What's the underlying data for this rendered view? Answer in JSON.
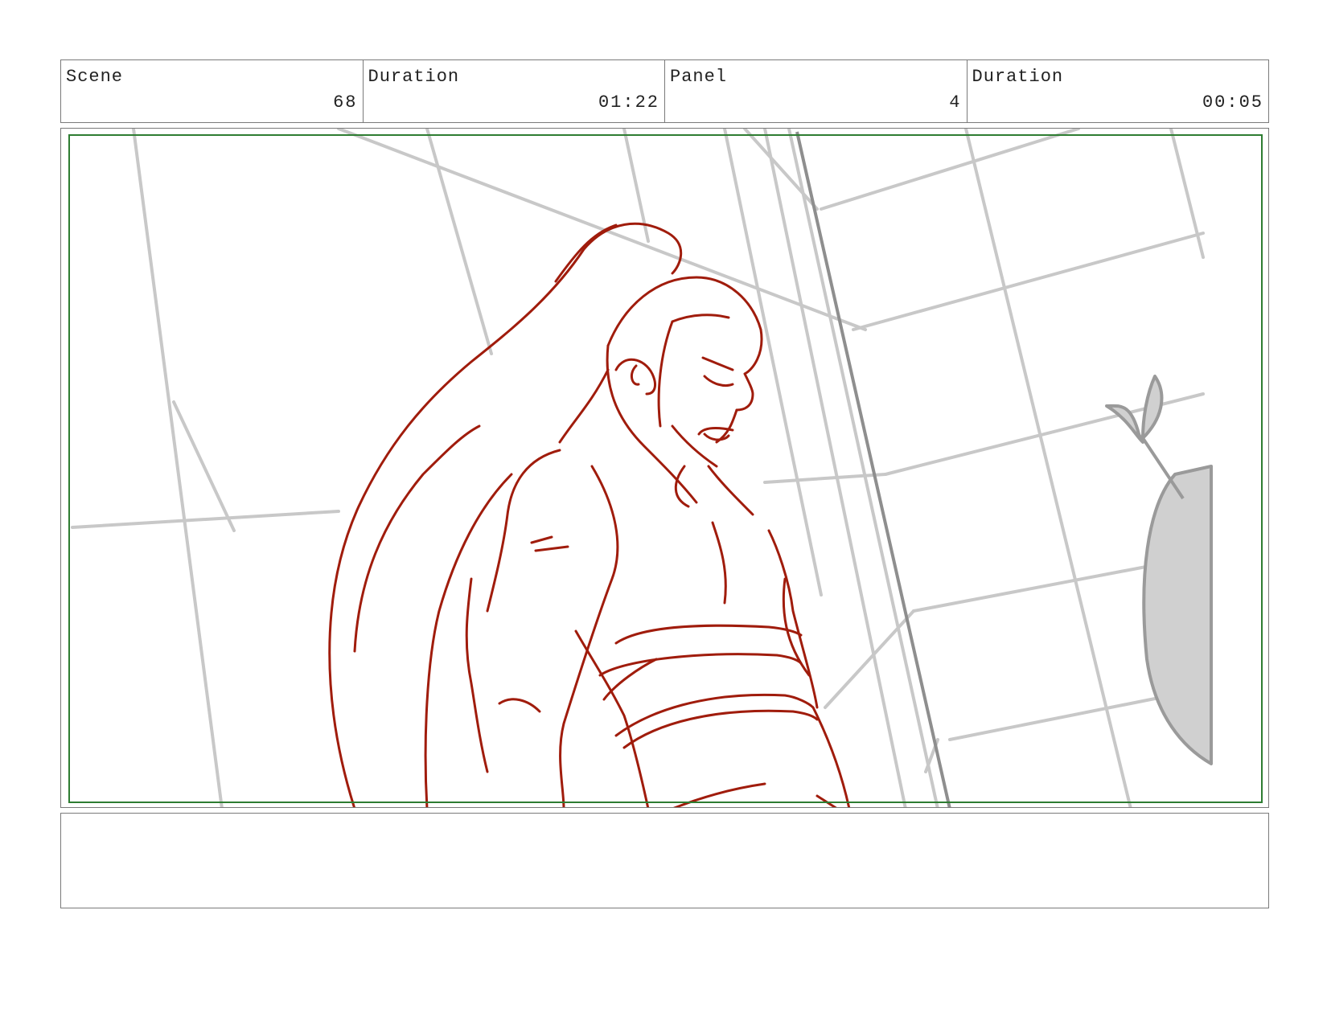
{
  "header": {
    "scene_label": "Scene",
    "scene_value": "68",
    "scene_duration_label": "Duration",
    "scene_duration_value": "01:22",
    "panel_label": "Panel",
    "panel_value": "4",
    "panel_duration_label": "Duration",
    "panel_duration_value": "00:05"
  },
  "colors": {
    "safe_frame": "#2e7d32",
    "character_lines": "#a01c0c",
    "background_lines": "#c8c8c8",
    "border": "#7a7a7a"
  },
  "notes": {
    "text": ""
  }
}
